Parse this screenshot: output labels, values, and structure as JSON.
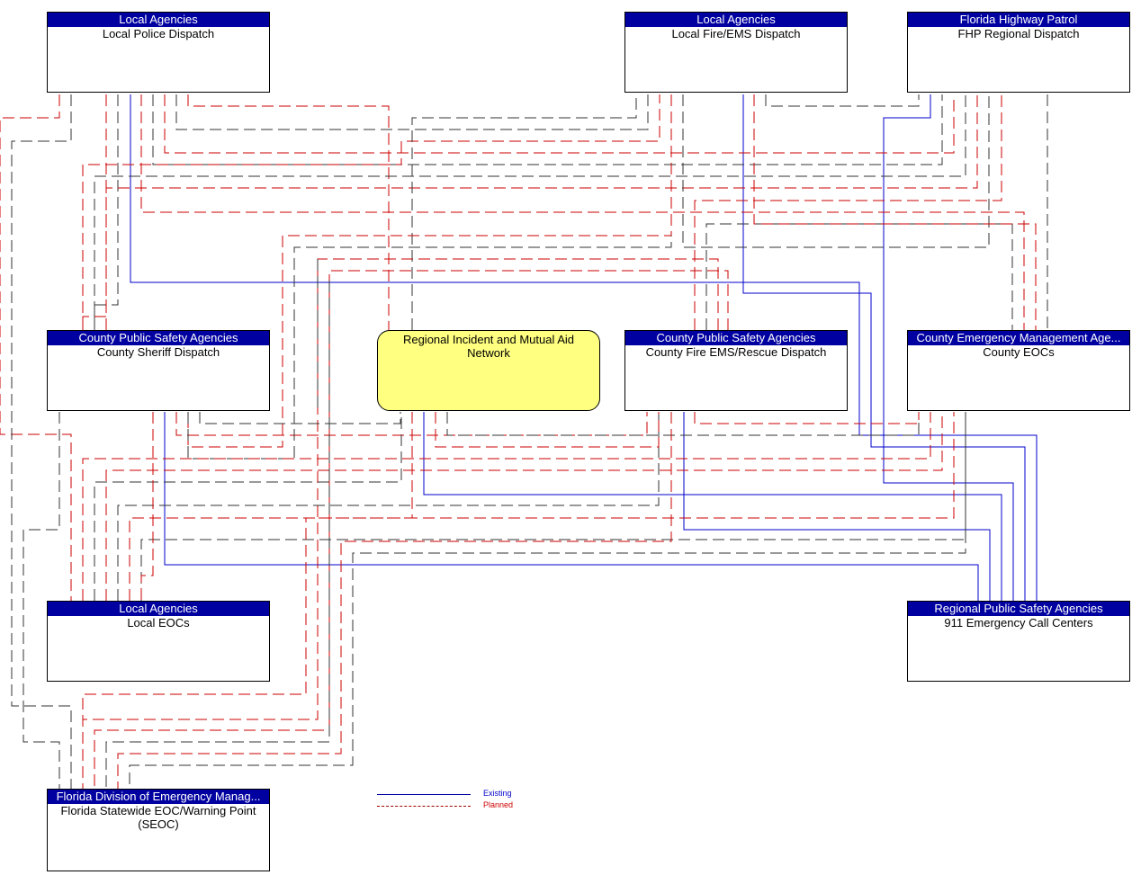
{
  "nodes": [
    {
      "id": "lpd",
      "agency": "Local Agencies",
      "name": "Local Police Dispatch"
    },
    {
      "id": "lfe",
      "agency": "Local Agencies",
      "name": "Local Fire/EMS Dispatch"
    },
    {
      "id": "fhp",
      "agency": "Florida Highway Patrol",
      "name": "FHP Regional Dispatch"
    },
    {
      "id": "csd",
      "agency": "County Public Safety Agencies",
      "name": "County Sheriff Dispatch"
    },
    {
      "id": "riman",
      "agency": "",
      "name": "Regional Incident and Mutual Aid Network"
    },
    {
      "id": "cfe",
      "agency": "County Public Safety Agencies",
      "name": "County Fire EMS/Rescue Dispatch"
    },
    {
      "id": "ceoc",
      "agency": "County Emergency Management Age...",
      "name": "County EOCs"
    },
    {
      "id": "leoc",
      "agency": "Local Agencies",
      "name": "Local EOCs"
    },
    {
      "id": "e911",
      "agency": "Regional Public Safety Agencies",
      "name": "911 Emergency Call Centers"
    },
    {
      "id": "seoc",
      "agency": "Florida Division of Emergency Manag...",
      "name": "Florida Statewide EOC/Warning Point (SEOC)"
    }
  ],
  "legend": {
    "existing": "Existing",
    "planned": "Planned"
  },
  "colors": {
    "existing": "#0000cc",
    "planned": "#cc0000",
    "header": "#0000a0",
    "center_fill": "#ffff80"
  }
}
